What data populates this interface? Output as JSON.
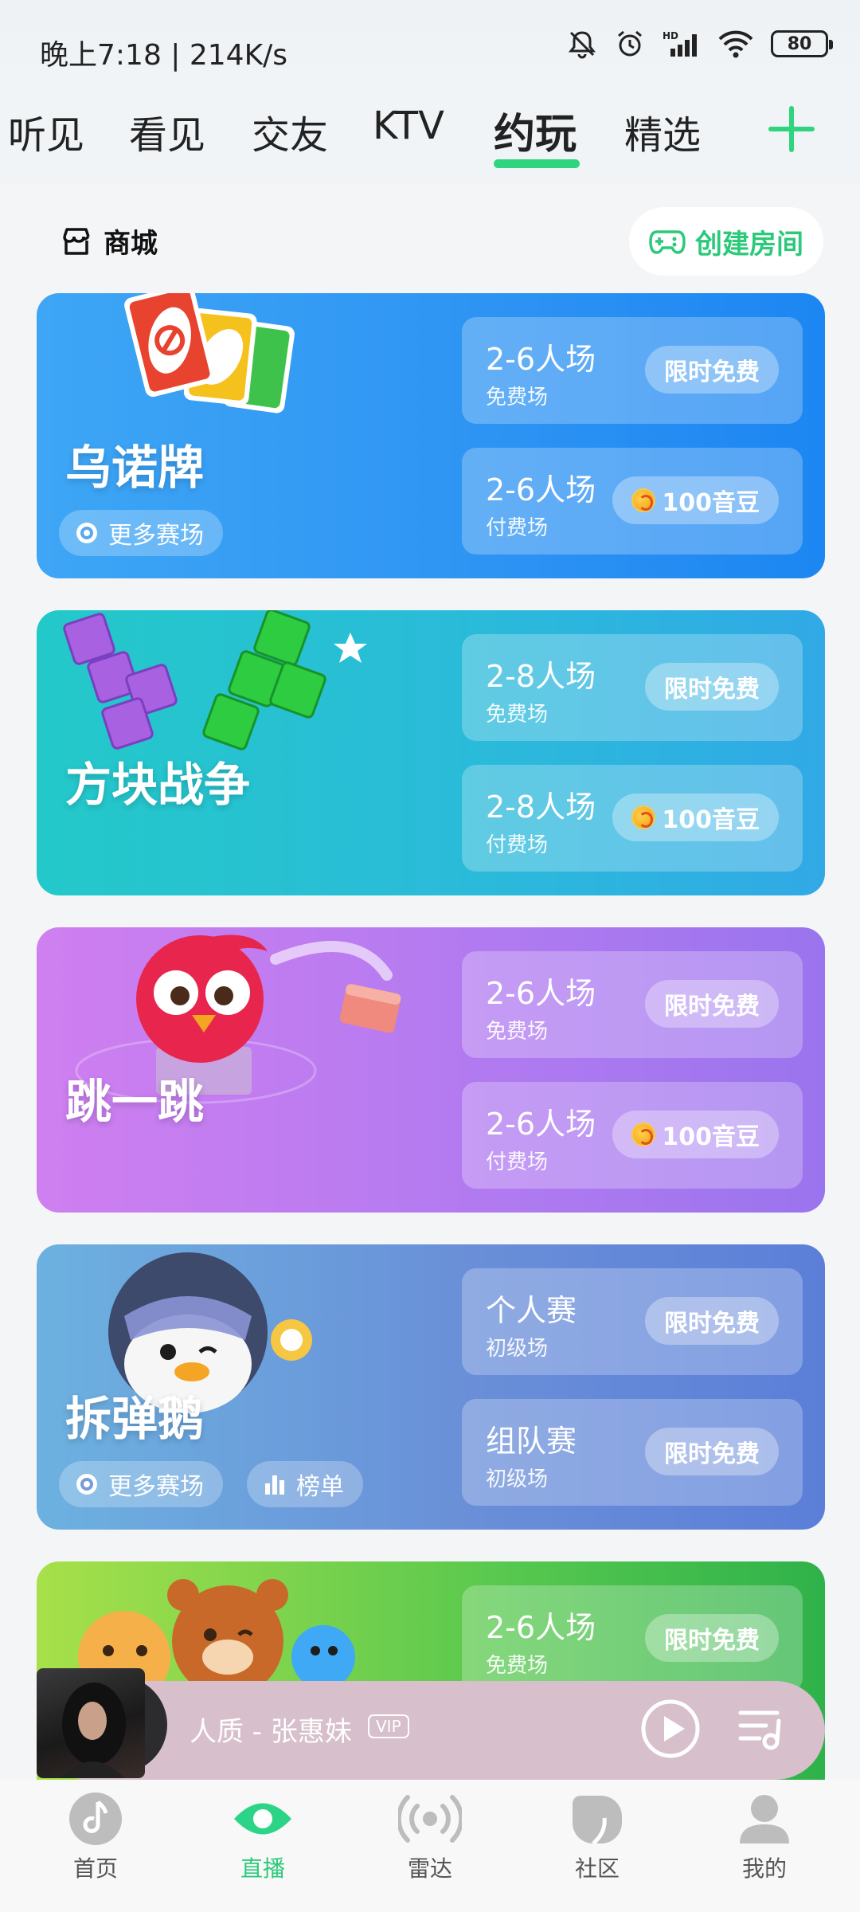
{
  "status_bar": {
    "time": "晚上7:18 | 214K/s",
    "battery": "80"
  },
  "top_tabs": [
    "听见",
    "看见",
    "交友",
    "KTV",
    "约玩",
    "精选"
  ],
  "active_tab": "约玩",
  "shop": {
    "label": "商城"
  },
  "create_room": {
    "label": "创建房间"
  },
  "games": [
    {
      "title": "乌诺牌",
      "sessions": [
        {
          "name": "2-6人场",
          "sub": "免费场",
          "badge": "限时免费"
        },
        {
          "name": "2-6人场",
          "sub": "付费场",
          "badge": "100音豆"
        }
      ],
      "pills": [
        "更多赛场"
      ]
    },
    {
      "title": "方块战争",
      "sessions": [
        {
          "name": "2-8人场",
          "sub": "免费场",
          "badge": "限时免费"
        },
        {
          "name": "2-8人场",
          "sub": "付费场",
          "badge": "100音豆"
        }
      ]
    },
    {
      "title": "跳一跳",
      "sessions": [
        {
          "name": "2-6人场",
          "sub": "免费场",
          "badge": "限时免费"
        },
        {
          "name": "2-6人场",
          "sub": "付费场",
          "badge": "100音豆"
        }
      ]
    },
    {
      "title": "拆弹鹅",
      "sessions": [
        {
          "name": "个人赛",
          "sub": "初级场",
          "badge": "限时免费"
        },
        {
          "name": "组队赛",
          "sub": "初级场",
          "badge": "限时免费"
        }
      ],
      "pills": [
        "更多赛场",
        "榜单"
      ]
    },
    {
      "sessions": [
        {
          "name": "2-6人场",
          "sub": "免费场",
          "badge": "限时免费"
        }
      ]
    }
  ],
  "player": {
    "song": "人质 - 张惠妹",
    "badge": "VIP"
  },
  "bottom_nav": [
    "首页",
    "直播",
    "雷达",
    "社区",
    "我的"
  ],
  "active_nav": "直播",
  "colors": {
    "accent": "#2cc97a",
    "card_uno": "#2d93f3",
    "card_tetris": "#2bb9db",
    "card_jump": "#b07af0",
    "card_goose": "#6a8fd8",
    "card_green": "#57c84f",
    "player_bg": "#d7bfcb"
  },
  "icons": {
    "status": [
      "mute-bell-icon",
      "alarm-icon",
      "signal-icon",
      "wifi-icon",
      "battery-icon"
    ],
    "shop": "store-icon",
    "create_room": "gamepad-icon",
    "pill": [
      "target-icon",
      "bar-chart-icon"
    ],
    "player": [
      "play-icon",
      "playlist-icon"
    ],
    "nav": [
      "music-note-icon",
      "eye-icon",
      "radar-icon",
      "community-icon",
      "user-icon"
    ]
  }
}
